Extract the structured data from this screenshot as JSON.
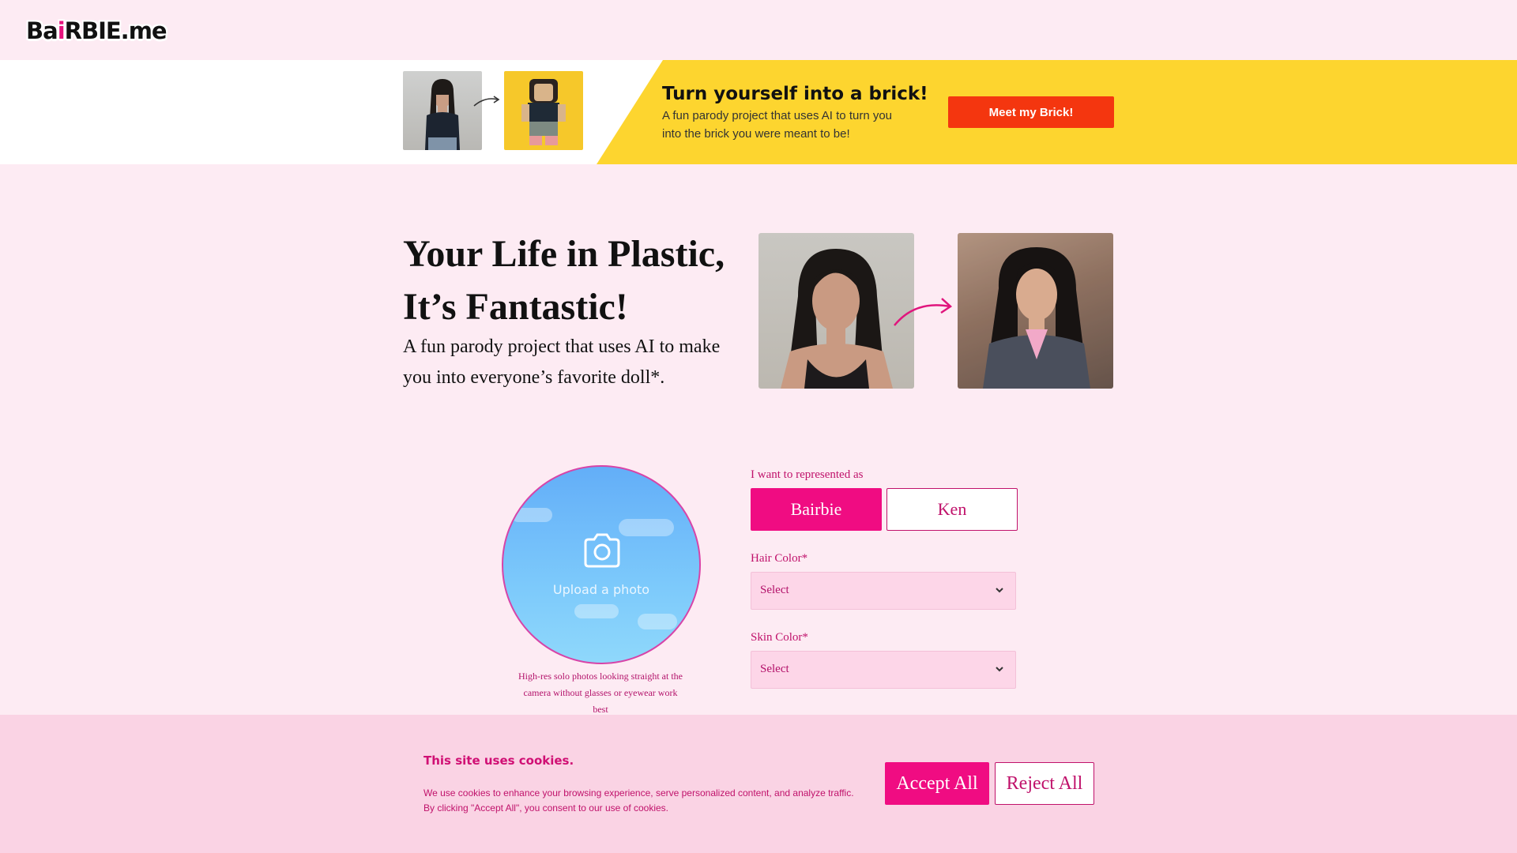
{
  "header": {
    "logo": {
      "part1": "Ba",
      "part2": "i",
      "part3": "RBIE.me"
    }
  },
  "banner": {
    "title": "Turn yourself into a brick!",
    "subtitle": "A fun parody project that uses AI to turn you into the brick you were meant to be!",
    "button_label": "Meet my Brick!",
    "colors": {
      "yellow": "#fdd52f",
      "button": "#f4360f"
    }
  },
  "hero": {
    "title_line1": "Your Life in Plastic,",
    "title_line2": "It’s Fantastic!",
    "subtitle": "A fun parody project that uses AI to make you into everyone’s favorite doll*."
  },
  "upload": {
    "label": "Upload a photo",
    "hint": "High-res solo photos looking straight at the camera without glasses or eyewear work best"
  },
  "form": {
    "represent_label": "I want to represented as",
    "options": [
      "Bairbie",
      "Ken"
    ],
    "selected_option": "Bairbie",
    "hair_color": {
      "label": "Hair Color*",
      "value": "Select"
    },
    "skin_color": {
      "label": "Skin Color*",
      "value": "Select"
    }
  },
  "cookie": {
    "title": "This site uses cookies.",
    "text_line1": "We use cookies to enhance your browsing experience, serve personalized content, and analyze traffic.",
    "text_line2": "By clicking \"Accept All\", you consent to our use of cookies.",
    "accept_label": "Accept All",
    "reject_label": "Reject All"
  },
  "colors": {
    "page_bg": "#fdebf3",
    "accent": "#f00c82",
    "accent_text": "#c0126b",
    "cookie_bg": "#fad3e4"
  }
}
